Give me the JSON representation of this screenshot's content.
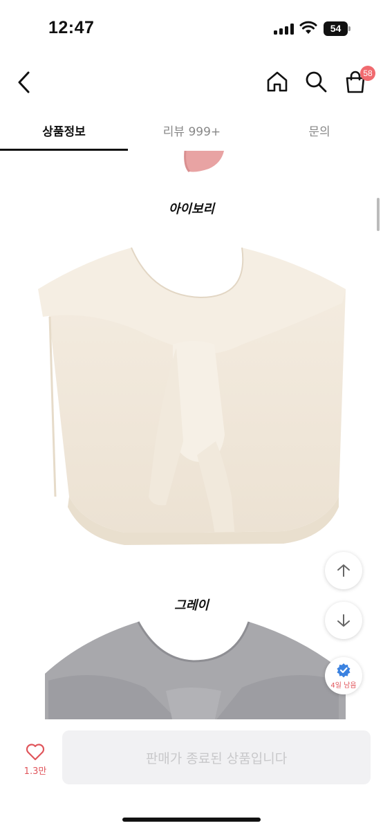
{
  "status_bar": {
    "time": "12:47",
    "battery": "54"
  },
  "header": {
    "back_icon": "chevron-left-icon",
    "home_icon": "home-icon",
    "search_icon": "search-icon",
    "cart_icon": "shopping-bag-icon",
    "cart_badge": "58",
    "badge_color": "#f06a6f"
  },
  "tabs": [
    {
      "label": "상품정보",
      "active": true
    },
    {
      "label": "리뷰 999+",
      "active": false
    },
    {
      "label": "문의",
      "active": false
    }
  ],
  "content": {
    "captions": [
      "아이보리",
      "그레이"
    ],
    "images": [
      "ivory-knit-shawl-vest",
      "gray-knit-shawl-vest"
    ]
  },
  "floating": {
    "scroll_up_icon": "arrow-up-icon",
    "scroll_down_icon": "arrow-down-icon",
    "verified_icon": "verified-badge-icon",
    "days_left": "4일 남음"
  },
  "bottom_bar": {
    "like_icon": "heart-icon",
    "like_count": "1.3만",
    "soldout_label": "판매가 종료된 상품입니다",
    "accent_color": "#e0555b"
  }
}
